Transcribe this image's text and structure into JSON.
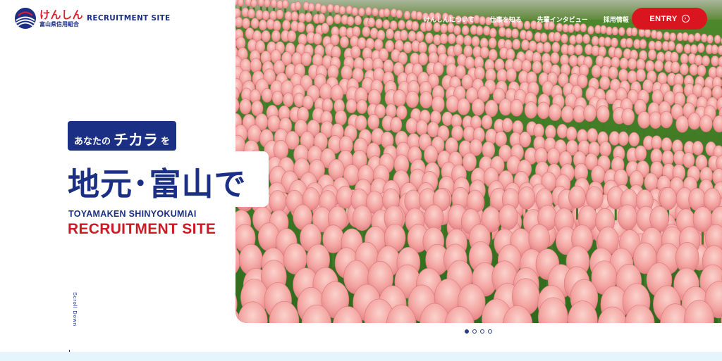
{
  "brand": {
    "name_kana": "けんしん",
    "name_full": "富山県信用組合",
    "site_label": "RECRUITMENT SITE",
    "icon": "kenshin-logo-icon",
    "colors": {
      "navy": "#1b2f84",
      "red": "#d9161f"
    }
  },
  "nav": {
    "items": [
      {
        "label": "けんしんについて"
      },
      {
        "label": "仕事を知る"
      },
      {
        "label": "先輩インタビュー"
      },
      {
        "label": "採用情報"
      }
    ],
    "entry_label": "ENTRY",
    "entry_icon": "arrow-circle-right-icon"
  },
  "hero": {
    "tag_part1": "あなたの",
    "tag_part2": "チカラ",
    "tag_part3": "を",
    "headline": "地元･富山で",
    "sub_english": "TOYAMAKEN SHINYOKUMIAI",
    "main_english": "RECRUITMENT SITE",
    "image": "pink-tulip-field-photo"
  },
  "scroll_label": "Scroll Down",
  "slider": {
    "count": 4,
    "active_index": 0
  }
}
